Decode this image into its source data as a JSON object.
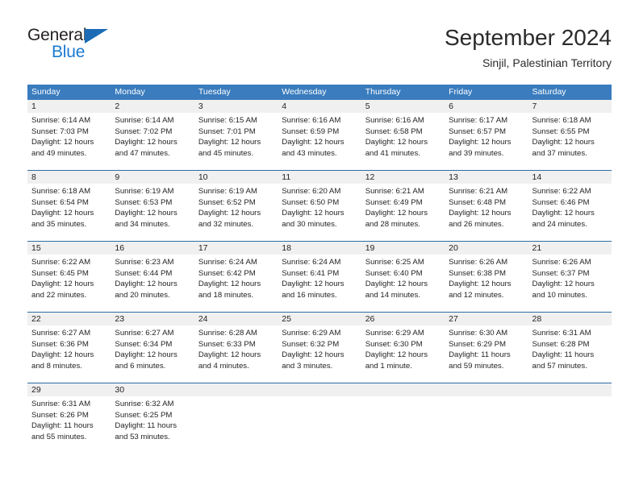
{
  "brand": {
    "word_one": "General",
    "word_two": "Blue",
    "triangle_color": "#1b6cb5",
    "blue_text_color": "#1b7ad1"
  },
  "header": {
    "title": "September 2024",
    "subtitle": "Sinjil, Palestinian Territory"
  },
  "theme": {
    "header_bg": "#3a7cbe",
    "header_text": "#ffffff",
    "day_band_bg": "#f0f0f0",
    "rule_color": "#2e6da4",
    "body_text": "#231f20"
  },
  "weekday_headers": [
    "Sunday",
    "Monday",
    "Tuesday",
    "Wednesday",
    "Thursday",
    "Friday",
    "Saturday"
  ],
  "weeks": [
    [
      {
        "day": "1",
        "sunrise": "Sunrise: 6:14 AM",
        "sunset": "Sunset: 7:03 PM",
        "daylight_1": "Daylight: 12 hours",
        "daylight_2": "and 49 minutes."
      },
      {
        "day": "2",
        "sunrise": "Sunrise: 6:14 AM",
        "sunset": "Sunset: 7:02 PM",
        "daylight_1": "Daylight: 12 hours",
        "daylight_2": "and 47 minutes."
      },
      {
        "day": "3",
        "sunrise": "Sunrise: 6:15 AM",
        "sunset": "Sunset: 7:01 PM",
        "daylight_1": "Daylight: 12 hours",
        "daylight_2": "and 45 minutes."
      },
      {
        "day": "4",
        "sunrise": "Sunrise: 6:16 AM",
        "sunset": "Sunset: 6:59 PM",
        "daylight_1": "Daylight: 12 hours",
        "daylight_2": "and 43 minutes."
      },
      {
        "day": "5",
        "sunrise": "Sunrise: 6:16 AM",
        "sunset": "Sunset: 6:58 PM",
        "daylight_1": "Daylight: 12 hours",
        "daylight_2": "and 41 minutes."
      },
      {
        "day": "6",
        "sunrise": "Sunrise: 6:17 AM",
        "sunset": "Sunset: 6:57 PM",
        "daylight_1": "Daylight: 12 hours",
        "daylight_2": "and 39 minutes."
      },
      {
        "day": "7",
        "sunrise": "Sunrise: 6:18 AM",
        "sunset": "Sunset: 6:55 PM",
        "daylight_1": "Daylight: 12 hours",
        "daylight_2": "and 37 minutes."
      }
    ],
    [
      {
        "day": "8",
        "sunrise": "Sunrise: 6:18 AM",
        "sunset": "Sunset: 6:54 PM",
        "daylight_1": "Daylight: 12 hours",
        "daylight_2": "and 35 minutes."
      },
      {
        "day": "9",
        "sunrise": "Sunrise: 6:19 AM",
        "sunset": "Sunset: 6:53 PM",
        "daylight_1": "Daylight: 12 hours",
        "daylight_2": "and 34 minutes."
      },
      {
        "day": "10",
        "sunrise": "Sunrise: 6:19 AM",
        "sunset": "Sunset: 6:52 PM",
        "daylight_1": "Daylight: 12 hours",
        "daylight_2": "and 32 minutes."
      },
      {
        "day": "11",
        "sunrise": "Sunrise: 6:20 AM",
        "sunset": "Sunset: 6:50 PM",
        "daylight_1": "Daylight: 12 hours",
        "daylight_2": "and 30 minutes."
      },
      {
        "day": "12",
        "sunrise": "Sunrise: 6:21 AM",
        "sunset": "Sunset: 6:49 PM",
        "daylight_1": "Daylight: 12 hours",
        "daylight_2": "and 28 minutes."
      },
      {
        "day": "13",
        "sunrise": "Sunrise: 6:21 AM",
        "sunset": "Sunset: 6:48 PM",
        "daylight_1": "Daylight: 12 hours",
        "daylight_2": "and 26 minutes."
      },
      {
        "day": "14",
        "sunrise": "Sunrise: 6:22 AM",
        "sunset": "Sunset: 6:46 PM",
        "daylight_1": "Daylight: 12 hours",
        "daylight_2": "and 24 minutes."
      }
    ],
    [
      {
        "day": "15",
        "sunrise": "Sunrise: 6:22 AM",
        "sunset": "Sunset: 6:45 PM",
        "daylight_1": "Daylight: 12 hours",
        "daylight_2": "and 22 minutes."
      },
      {
        "day": "16",
        "sunrise": "Sunrise: 6:23 AM",
        "sunset": "Sunset: 6:44 PM",
        "daylight_1": "Daylight: 12 hours",
        "daylight_2": "and 20 minutes."
      },
      {
        "day": "17",
        "sunrise": "Sunrise: 6:24 AM",
        "sunset": "Sunset: 6:42 PM",
        "daylight_1": "Daylight: 12 hours",
        "daylight_2": "and 18 minutes."
      },
      {
        "day": "18",
        "sunrise": "Sunrise: 6:24 AM",
        "sunset": "Sunset: 6:41 PM",
        "daylight_1": "Daylight: 12 hours",
        "daylight_2": "and 16 minutes."
      },
      {
        "day": "19",
        "sunrise": "Sunrise: 6:25 AM",
        "sunset": "Sunset: 6:40 PM",
        "daylight_1": "Daylight: 12 hours",
        "daylight_2": "and 14 minutes."
      },
      {
        "day": "20",
        "sunrise": "Sunrise: 6:26 AM",
        "sunset": "Sunset: 6:38 PM",
        "daylight_1": "Daylight: 12 hours",
        "daylight_2": "and 12 minutes."
      },
      {
        "day": "21",
        "sunrise": "Sunrise: 6:26 AM",
        "sunset": "Sunset: 6:37 PM",
        "daylight_1": "Daylight: 12 hours",
        "daylight_2": "and 10 minutes."
      }
    ],
    [
      {
        "day": "22",
        "sunrise": "Sunrise: 6:27 AM",
        "sunset": "Sunset: 6:36 PM",
        "daylight_1": "Daylight: 12 hours",
        "daylight_2": "and 8 minutes."
      },
      {
        "day": "23",
        "sunrise": "Sunrise: 6:27 AM",
        "sunset": "Sunset: 6:34 PM",
        "daylight_1": "Daylight: 12 hours",
        "daylight_2": "and 6 minutes."
      },
      {
        "day": "24",
        "sunrise": "Sunrise: 6:28 AM",
        "sunset": "Sunset: 6:33 PM",
        "daylight_1": "Daylight: 12 hours",
        "daylight_2": "and 4 minutes."
      },
      {
        "day": "25",
        "sunrise": "Sunrise: 6:29 AM",
        "sunset": "Sunset: 6:32 PM",
        "daylight_1": "Daylight: 12 hours",
        "daylight_2": "and 3 minutes."
      },
      {
        "day": "26",
        "sunrise": "Sunrise: 6:29 AM",
        "sunset": "Sunset: 6:30 PM",
        "daylight_1": "Daylight: 12 hours",
        "daylight_2": "and 1 minute."
      },
      {
        "day": "27",
        "sunrise": "Sunrise: 6:30 AM",
        "sunset": "Sunset: 6:29 PM",
        "daylight_1": "Daylight: 11 hours",
        "daylight_2": "and 59 minutes."
      },
      {
        "day": "28",
        "sunrise": "Sunrise: 6:31 AM",
        "sunset": "Sunset: 6:28 PM",
        "daylight_1": "Daylight: 11 hours",
        "daylight_2": "and 57 minutes."
      }
    ],
    [
      {
        "day": "29",
        "sunrise": "Sunrise: 6:31 AM",
        "sunset": "Sunset: 6:26 PM",
        "daylight_1": "Daylight: 11 hours",
        "daylight_2": "and 55 minutes."
      },
      {
        "day": "30",
        "sunrise": "Sunrise: 6:32 AM",
        "sunset": "Sunset: 6:25 PM",
        "daylight_1": "Daylight: 11 hours",
        "daylight_2": "and 53 minutes."
      },
      {
        "day": "",
        "sunrise": "",
        "sunset": "",
        "daylight_1": "",
        "daylight_2": ""
      },
      {
        "day": "",
        "sunrise": "",
        "sunset": "",
        "daylight_1": "",
        "daylight_2": ""
      },
      {
        "day": "",
        "sunrise": "",
        "sunset": "",
        "daylight_1": "",
        "daylight_2": ""
      },
      {
        "day": "",
        "sunrise": "",
        "sunset": "",
        "daylight_1": "",
        "daylight_2": ""
      },
      {
        "day": "",
        "sunrise": "",
        "sunset": "",
        "daylight_1": "",
        "daylight_2": ""
      }
    ]
  ]
}
